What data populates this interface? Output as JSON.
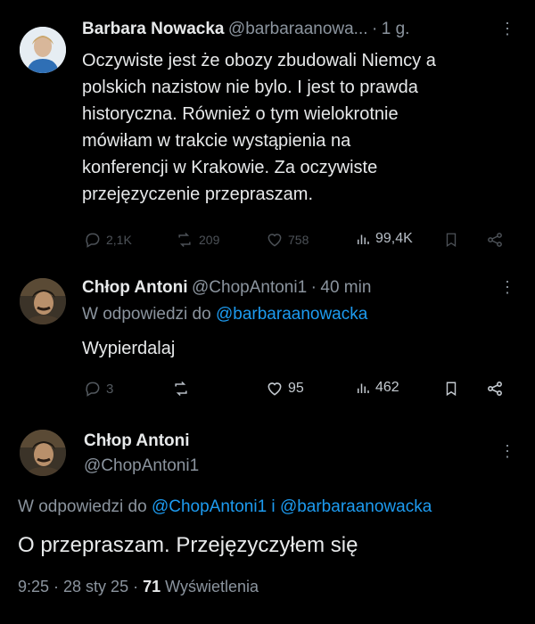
{
  "tweet1": {
    "name": "Barbara Nowacka",
    "handle": "@barbaraanowa...",
    "separator": "·",
    "time": "1 g.",
    "lines": [
      "Oczywiste jest że obozy zbudowali Niemcy a",
      "polskich nazistow nie bylo. I jest to prawda",
      "historyczna. Również o tym wielokrotnie",
      "mówiłam w trakcie wystąpienia na",
      "konferencji w Krakowie. Za oczywiste",
      "przejęzyczenie przepraszam."
    ],
    "replies": "2,1K",
    "reposts": "209",
    "likes": "758",
    "views": "99,4K"
  },
  "tweet2": {
    "name": "Chłop Antoni",
    "handle": "@ChopAntoni1",
    "separator": "·",
    "time": "40 min",
    "reply_prefix": "W odpowiedzi do",
    "reply_to": "@barbaraanowacka",
    "text": "Wypierdalaj",
    "replies": "3",
    "likes": "95",
    "views": "462"
  },
  "tweet3": {
    "name": "Chłop Antoni",
    "handle": "@ChopAntoni1",
    "reply_prefix": "W odpowiedzi do",
    "reply_to_1": "@ChopAntoni1",
    "reply_and": "i",
    "reply_to_2": "@barbaraanowacka",
    "text": "O przepraszam. Przejęzyczyłem się",
    "timestamp": "9:25 · 28 sty 25 ·",
    "views_count": "71",
    "views_label": "Wyświetlenia"
  },
  "colors": {
    "background": "#000000",
    "text": "#e7e9ea",
    "secondary": "#8b949e",
    "link": "#1d9bf0"
  }
}
